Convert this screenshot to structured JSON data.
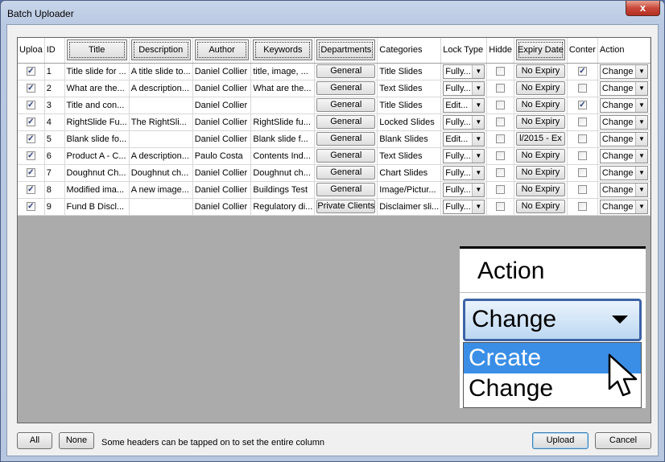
{
  "window": {
    "title": "Batch Uploader",
    "close_label": "x"
  },
  "columns": {
    "upload": "Uploa",
    "id": "ID",
    "title": "Title",
    "description": "Description",
    "author": "Author",
    "keywords": "Keywords",
    "departments": "Departments",
    "categories": "Categories",
    "lock_type": "Lock Type",
    "hidden": "Hidde",
    "expiry_date": "Expiry Date",
    "content": "Conter",
    "action": "Action"
  },
  "rows": [
    {
      "upload": true,
      "id": "1",
      "title": "Title slide for ...",
      "description": "A title slide to...",
      "author": "Daniel Collier",
      "keywords": "title, image, ...",
      "department": "General",
      "category": "Title Slides",
      "lock": "Fully...",
      "hidden": false,
      "expiry": "No Expiry",
      "content": true,
      "action": "Change"
    },
    {
      "upload": true,
      "id": "2",
      "title": "What are the...",
      "description": "A description...",
      "author": "Daniel Collier",
      "keywords": "What are the...",
      "department": "General",
      "category": "Text Slides",
      "lock": "Fully...",
      "hidden": false,
      "expiry": "No Expiry",
      "content": false,
      "action": "Change"
    },
    {
      "upload": true,
      "id": "3",
      "title": "Title and con...",
      "description": "",
      "author": "Daniel Collier",
      "keywords": "",
      "department": "General",
      "category": "Title Slides",
      "lock": "Edit...",
      "hidden": false,
      "expiry": "No Expiry",
      "content": true,
      "action": "Change"
    },
    {
      "upload": true,
      "id": "4",
      "title": "RightSlide Fu...",
      "description": "The RightSli...",
      "author": "Daniel Collier",
      "keywords": "RightSlide fu...",
      "department": "General",
      "category": "Locked Slides",
      "lock": "Fully...",
      "hidden": false,
      "expiry": "No Expiry",
      "content": false,
      "action": "Change"
    },
    {
      "upload": true,
      "id": "5",
      "title": "Blank slide fo...",
      "description": "",
      "author": "Daniel Collier",
      "keywords": "Blank slide f...",
      "department": "General",
      "category": "Blank Slides",
      "lock": "Edit...",
      "hidden": false,
      "expiry": "l/2015 - Ex",
      "content": false,
      "action": "Change"
    },
    {
      "upload": true,
      "id": "6",
      "title": "Product A - C...",
      "description": "A description...",
      "author": "Paulo Costa",
      "keywords": "Contents Ind...",
      "department": "General",
      "category": "Text Slides",
      "lock": "Fully...",
      "hidden": false,
      "expiry": "No Expiry",
      "content": false,
      "action": "Change"
    },
    {
      "upload": true,
      "id": "7",
      "title": "Doughnut Ch...",
      "description": "Doughnut ch...",
      "author": "Daniel Collier",
      "keywords": "Doughnut ch...",
      "department": "General",
      "category": "Chart Slides",
      "lock": "Fully...",
      "hidden": false,
      "expiry": "No Expiry",
      "content": false,
      "action": "Change"
    },
    {
      "upload": true,
      "id": "8",
      "title": "Modified ima...",
      "description": "A new image...",
      "author": "Daniel Collier",
      "keywords": "Buildings Test",
      "department": "General",
      "category": "Image/Pictur...",
      "lock": "Fully...",
      "hidden": false,
      "expiry": "No Expiry",
      "content": false,
      "action": "Change"
    },
    {
      "upload": true,
      "id": "9",
      "title": "Fund B Discl...",
      "description": "",
      "author": "Daniel Collier",
      "keywords": "Regulatory di...",
      "department": "Private Clients",
      "category": "Disclaimer sli...",
      "lock": "Fully...",
      "hidden": false,
      "expiry": "No Expiry",
      "content": false,
      "action": "Change"
    }
  ],
  "zoom": {
    "header": "Action",
    "value": "Change",
    "options": [
      "Create",
      "Change"
    ],
    "highlighted": "Create"
  },
  "footer": {
    "all_label": "All",
    "none_label": "None",
    "hint": "Some headers can be tapped on to set the entire column",
    "upload_label": "Upload",
    "cancel_label": "Cancel"
  }
}
